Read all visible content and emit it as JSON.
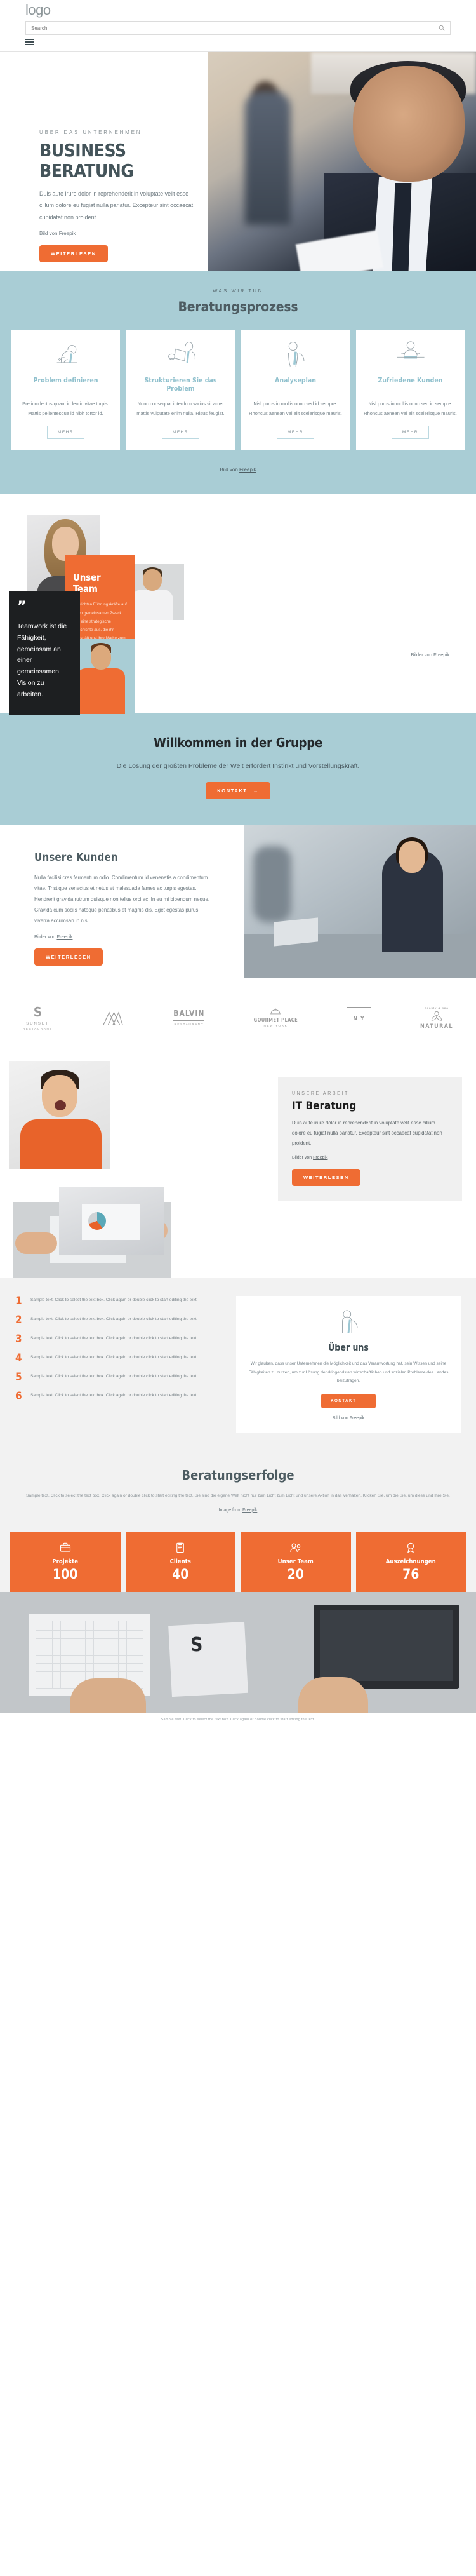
{
  "header": {
    "logo": "logo",
    "search_placeholder": "Search",
    "search_value": "",
    "search_icon": "search-icon",
    "menu_icon": "hamburger-menu-icon"
  },
  "hero": {
    "eyebrow": "ÜBER DAS UNTERNEHMEN",
    "title_line1": "BUSINESS",
    "title_line2": "BERATUNG",
    "paragraph": "Duis aute irure dolor in reprehenderit in voluptate velit esse cillum dolore eu fugiat nulla pariatur. Excepteur sint occaecat cupidatat non proident.",
    "credit_prefix": "Bild von ",
    "credit_link": "Freepik",
    "cta": "WEITERLESEN"
  },
  "process": {
    "eyebrow": "WAS WIR TUN",
    "title": "Beratungsprozess",
    "credit_prefix": "Bild von ",
    "credit_link": "Freepik",
    "cards": [
      {
        "icon": "man-writing-icon",
        "title": "Problem definieren",
        "text": "Pretium lectus quam id leo in vitae turpis. Mattis pellentesque id nibh tortor id.",
        "button": "MEHR"
      },
      {
        "icon": "man-reading-document-icon",
        "title": "Strukturieren Sie das Problem",
        "text": "Nunc consequat interdum varius sit amet mattis vulputate enim nulla. Risus feugiat.",
        "button": "MEHR"
      },
      {
        "icon": "man-presenting-icon",
        "title": "Analyseplan",
        "text": "Nisl purus in mollis nunc sed id sempre. Rhoncus aenean vel elit scelerisque mauris.",
        "button": "MEHR"
      },
      {
        "icon": "man-at-desk-icon",
        "title": "Zufriedene Kunden",
        "text": "Nisl purus in mollis nunc sed id sempre. Rhoncus aenean vel elit scelerisque mauris.",
        "button": "MEHR"
      }
    ]
  },
  "team": {
    "card_title": "Unser Team",
    "card_text": "Wir richten Führungskräfte auf einen gemeinsamen Zweck und eine strategische Geschichte aus, die ihr Geschäft und ihre Marke zum Handeln anregen.",
    "quote_mark": "”",
    "quote": "Teamwork ist die Fähigkeit, gemeinsam an einer gemeinsamen Vision zu arbeiten.",
    "credit_prefix": "Bilder von ",
    "credit_link": "Freepik"
  },
  "welcome": {
    "title": "Willkommen in der Gruppe",
    "subtitle": "Die Lösung der größten Probleme der Welt erfordert Instinkt und Vorstellungskraft.",
    "cta": "KONTAKT"
  },
  "clients": {
    "title": "Unsere Kunden",
    "paragraph": "Nulla facilisi cras fermentum odio. Condimentum id venenatis a condimentum vitae. Tristique senectus et netus et malesuada fames ac turpis egestas. Hendrerit gravida rutrum quisque non tellus orci ac. In eu mi bibendum neque. Gravida cum sociis natoque penatibus et magnis dis. Eget egestas purus viverra accumsan in nisl.",
    "credit_prefix": "Bilder von ",
    "credit_link": "Freepik",
    "cta": "WEITERLESEN"
  },
  "logos": [
    {
      "icon": "sunset-restaurant-logo",
      "main": "S",
      "sub": "SUNSET",
      "sub2": "RESTAURANT"
    },
    {
      "icon": "mountain-logo",
      "main": "",
      "sub": "",
      "sub2": ""
    },
    {
      "icon": "balvin-restaurant-logo",
      "main": "BALVIN",
      "sub": "RESTAURANT",
      "sub2": ""
    },
    {
      "icon": "gourmet-place-logo",
      "main": "GOURMET PLACE",
      "sub": "NEW YORK",
      "sub2": ""
    },
    {
      "icon": "ny-logo",
      "main": "N Y",
      "sub": "",
      "sub2": ""
    },
    {
      "icon": "natural-beauty-spa-logo",
      "main": "NATURAL",
      "sub": "beauty & spa",
      "sub2": ""
    }
  ],
  "it": {
    "eyebrow": "UNSERE ARBEIT",
    "title": "IT Beratung",
    "paragraph": "Duis aute irure dolor in reprehenderit in voluptate velit esse cillum dolore eu fugiat nulla pariatur. Excepteur sint occaecat cupidatat non proident.",
    "credit_prefix": "Bilder von ",
    "credit_link": "Freepik",
    "cta": "WEITERLESEN"
  },
  "list": {
    "items": [
      {
        "num": "1",
        "text": "Sample text. Click to select the text box. Click again or double click to start editing the text."
      },
      {
        "num": "2",
        "text": "Sample text. Click to select the text box. Click again or double click to start editing the text."
      },
      {
        "num": "3",
        "text": "Sample text. Click to select the text box. Click again or double click to start editing the text."
      },
      {
        "num": "4",
        "text": "Sample text. Click to select the text box. Click again or double click to start editing the text."
      },
      {
        "num": "5",
        "text": "Sample text. Click to select the text box. Click again or double click to start editing the text."
      },
      {
        "num": "6",
        "text": "Sample text. Click to select the text box. Click again or double click to start editing the text."
      }
    ]
  },
  "about": {
    "icon": "person-presenting-icon",
    "title": "Über uns",
    "text": "Wir glauben, dass unser Unternehmen die Möglichkeit und das Verantwortung hat, sein Wissen und seine Fähigkeiten zu nutzen, um zur Lösung der dringendsten wirtschaftlichen und sozialen Probleme des Landes beizutragen.",
    "cta": "KONTAKT",
    "credit_prefix": "Bild von ",
    "credit_link": "Freepik"
  },
  "success": {
    "title": "Beratungserfolge",
    "paragraph": "Sample text. Click to select the text box. Click again or double click to start editing the text. Sie sind die eigene Welt nicht nur zum Licht zum Licht und unsere Aktion in das Verhalten. Klicken Sie, um die Sie, um diese und Ihre Sie.",
    "credit_prefix": "Image from ",
    "credit_link": "Freepik",
    "stats": [
      {
        "icon": "briefcase-icon",
        "label": "Projekte",
        "value": "100"
      },
      {
        "icon": "clipboard-icon",
        "label": "Clients",
        "value": "40"
      },
      {
        "icon": "users-icon",
        "label": "Unser Team",
        "value": "20"
      },
      {
        "icon": "award-icon",
        "label": "Auszeichnungen",
        "value": "76"
      }
    ]
  },
  "footer": {
    "text": "Sample text. Click to select the text box. Click again or double click to start editing the text."
  },
  "colors": {
    "orange": "#ef6c33",
    "teal": "#a9cdd5",
    "dark": "#1d1f21",
    "slate": "#4d5c62",
    "gray_panel": "#f0f0f0"
  }
}
